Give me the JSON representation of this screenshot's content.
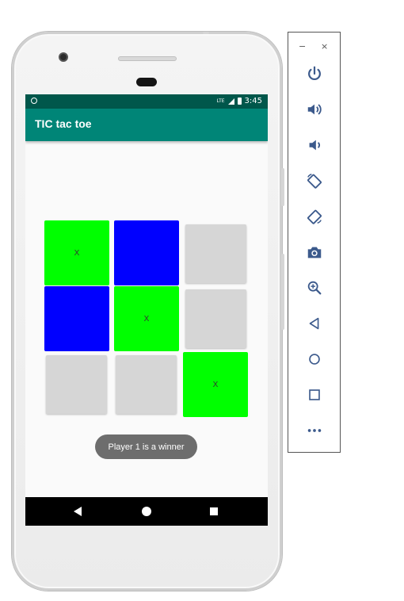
{
  "app": {
    "title": "TIC tac toe"
  },
  "status_bar": {
    "network": "LTE",
    "time": "3:45"
  },
  "board": {
    "cells": [
      {
        "mark": "X",
        "state": "green"
      },
      {
        "mark": "",
        "state": "blue"
      },
      {
        "mark": "",
        "state": "empty"
      },
      {
        "mark": "",
        "state": "blue"
      },
      {
        "mark": "X",
        "state": "green"
      },
      {
        "mark": "",
        "state": "empty"
      },
      {
        "mark": "",
        "state": "empty"
      },
      {
        "mark": "",
        "state": "empty"
      },
      {
        "mark": "X",
        "state": "green"
      }
    ]
  },
  "toast": {
    "message": "Player 1 is a winner"
  },
  "colors": {
    "status_bar": "#00574b",
    "app_bar": "#008577",
    "player1": "#00ff00",
    "player2": "#0000ff",
    "empty_cell": "#d6d6d6",
    "toast_bg": "#6d6d6d"
  },
  "nav_bar": {
    "buttons": [
      "back-icon",
      "home-icon",
      "recents-icon"
    ]
  },
  "emulator_toolbar": {
    "window_buttons": {
      "minimize": "−",
      "close": "×"
    },
    "tools": [
      "power-icon",
      "volume-up-icon",
      "volume-down-icon",
      "rotate-left-icon",
      "rotate-right-icon",
      "camera-icon",
      "zoom-icon",
      "back-icon",
      "home-icon",
      "overview-icon",
      "more-icon"
    ]
  }
}
